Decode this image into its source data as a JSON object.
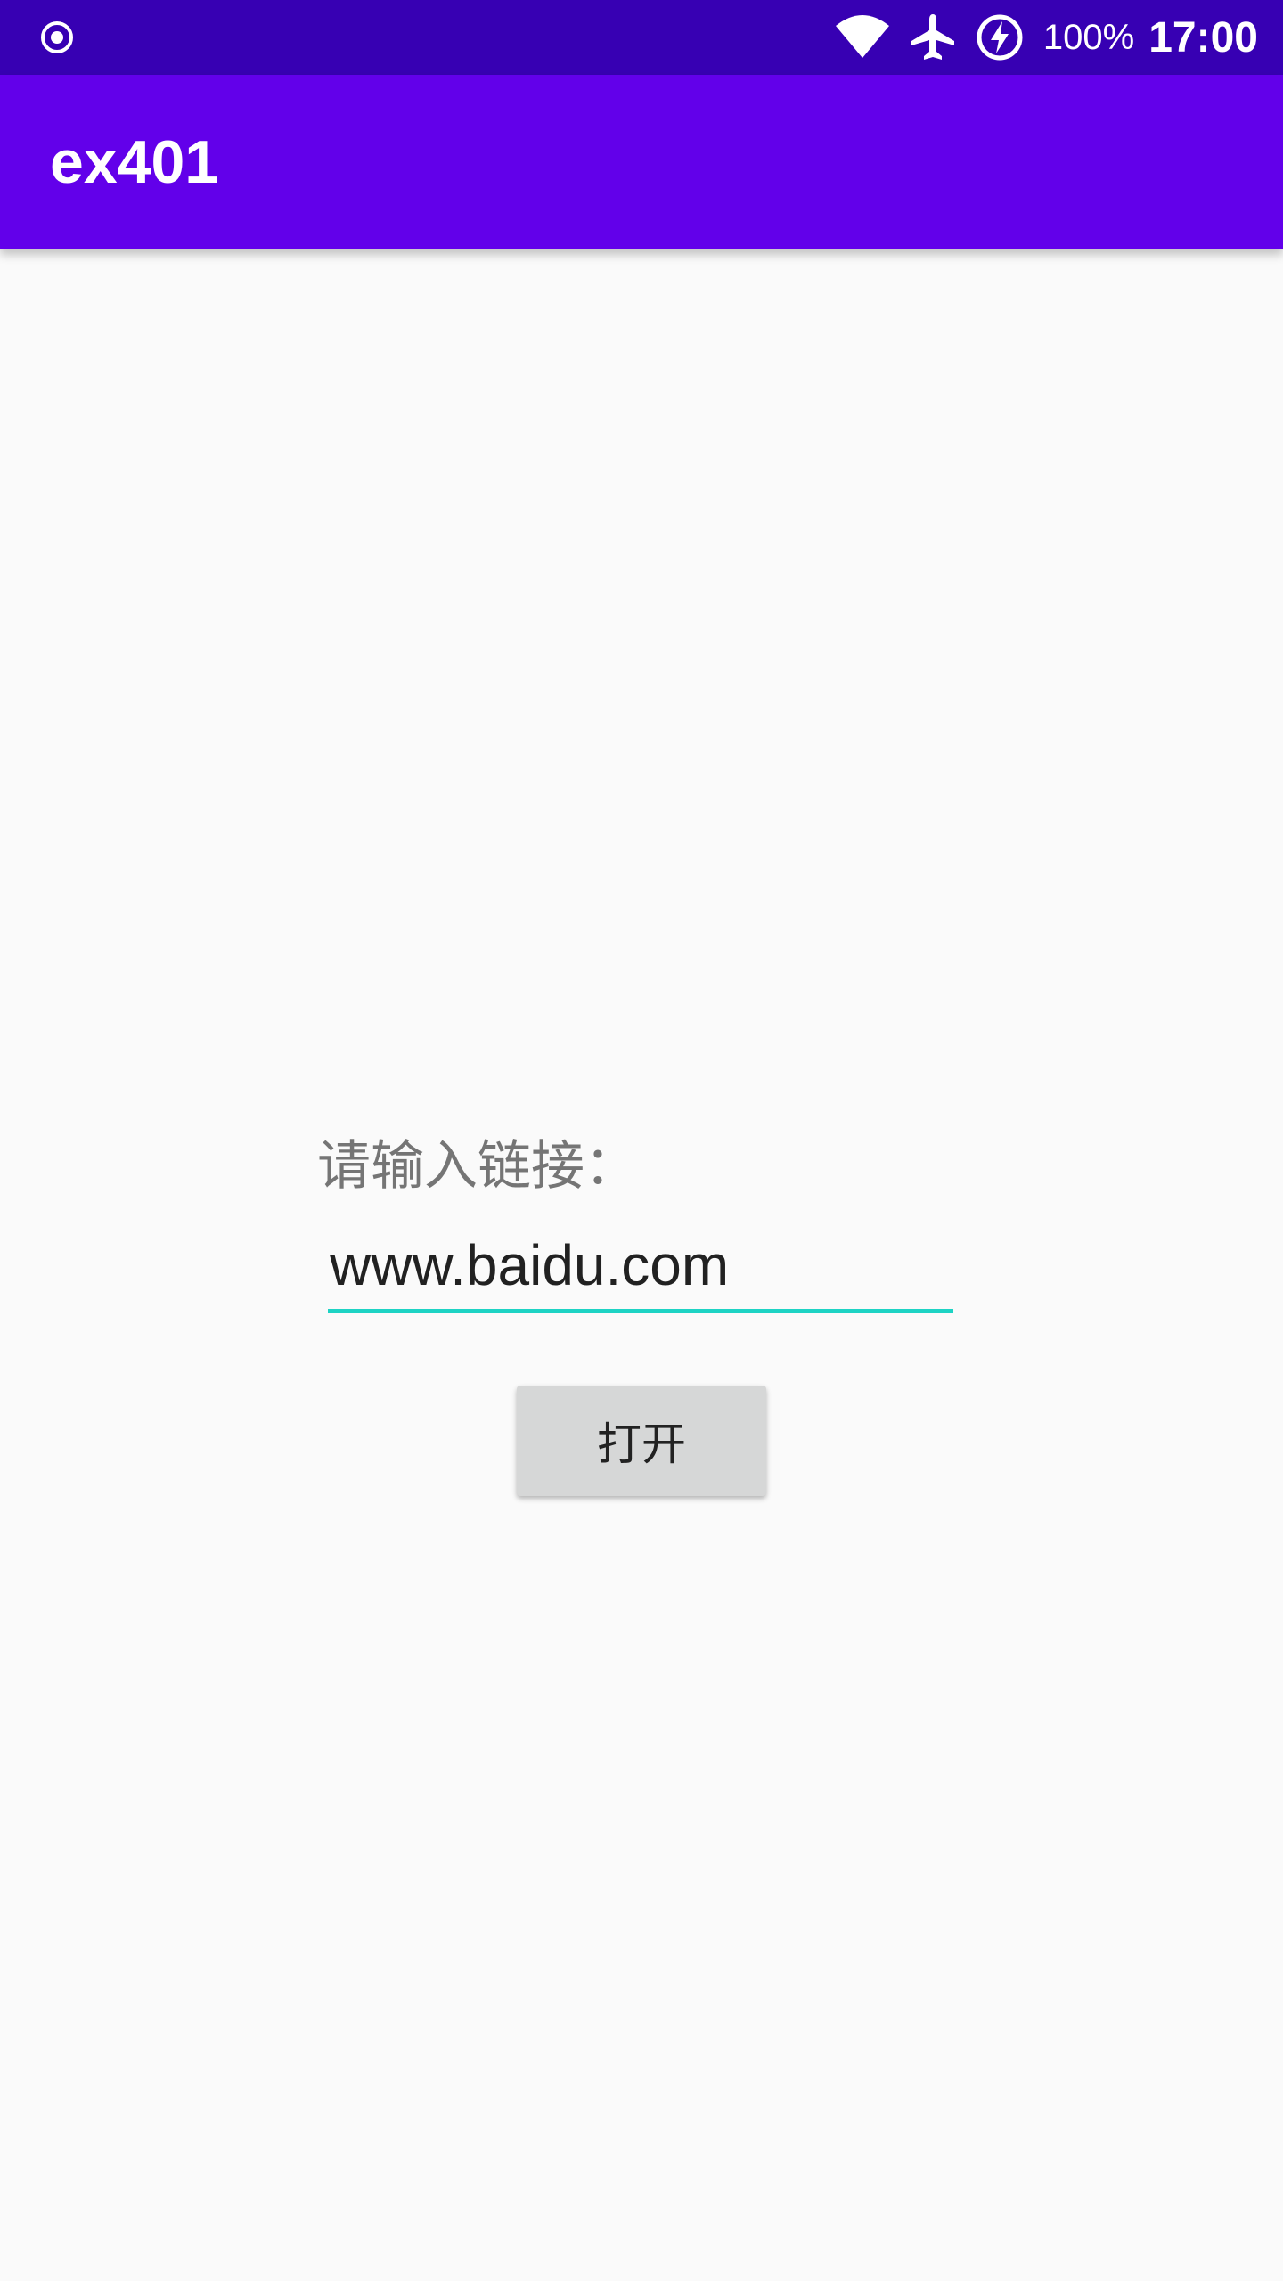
{
  "status_bar": {
    "left_icon": "record-circle-icon",
    "icons": [
      "wifi-icon",
      "airplane-mode-icon",
      "battery-charging-icon"
    ],
    "battery_percent": "100%",
    "time": "17:00"
  },
  "app_bar": {
    "title": "ex401",
    "color": "#6200ea"
  },
  "form": {
    "prompt_label": "请输入链接：",
    "url_value": "www.baidu.com",
    "open_button_label": "打开"
  },
  "colors": {
    "status_bar": "#3700b3",
    "app_bar": "#6200ea",
    "input_underline": "#1dd3c4",
    "button_bg": "#d6d7d7",
    "background": "#fafafa"
  }
}
